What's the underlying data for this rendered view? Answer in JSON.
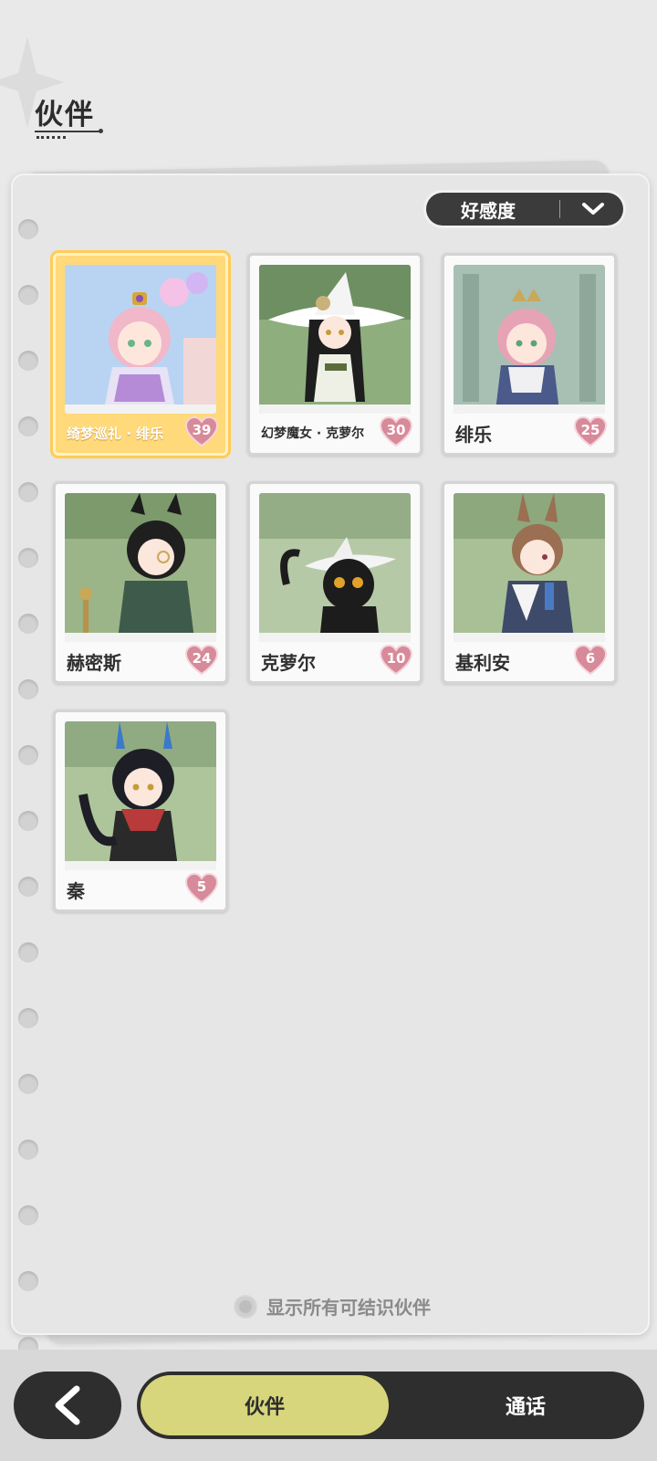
{
  "header": {
    "title": "伙伴"
  },
  "sort": {
    "label": "好感度"
  },
  "partners": [
    {
      "name": "绮梦巡礼 · 绯乐",
      "affinity": "39",
      "selected": true
    },
    {
      "name": "幻梦魔女 · 克萝尔",
      "affinity": "30",
      "selected": false
    },
    {
      "name": "绯乐",
      "affinity": "25",
      "selected": false
    },
    {
      "name": "赫密斯",
      "affinity": "24",
      "selected": false
    },
    {
      "name": "克萝尔",
      "affinity": "10",
      "selected": false
    },
    {
      "name": "基利安",
      "affinity": "6",
      "selected": false
    },
    {
      "name": "秦",
      "affinity": "5",
      "selected": false
    }
  ],
  "footer": {
    "show_all_label": "显示所有可结识伙伴"
  },
  "bottom_bar": {
    "tab_partner": "伙伴",
    "tab_call": "通话"
  },
  "colors": {
    "accent": "#d7d67d",
    "dark": "#2e2e2e",
    "heart": "#e08a9a",
    "selected_card": "#ffcc55"
  }
}
